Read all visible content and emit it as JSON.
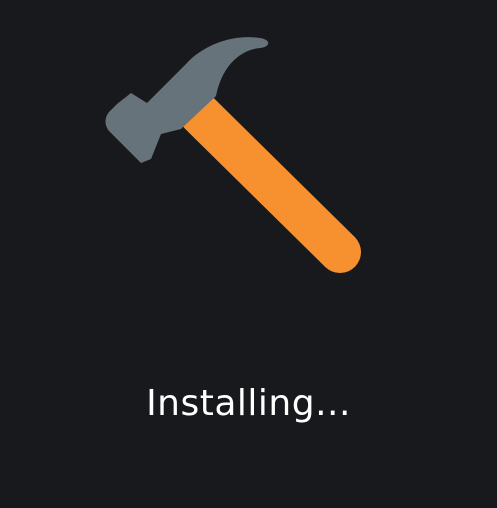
{
  "installer": {
    "icon": "hammer-icon",
    "status_label": "Installing..."
  },
  "colors": {
    "background": "#18191d",
    "hammer_head": "#66737b",
    "hammer_handle": "#f79130",
    "text": "#ffffff"
  }
}
